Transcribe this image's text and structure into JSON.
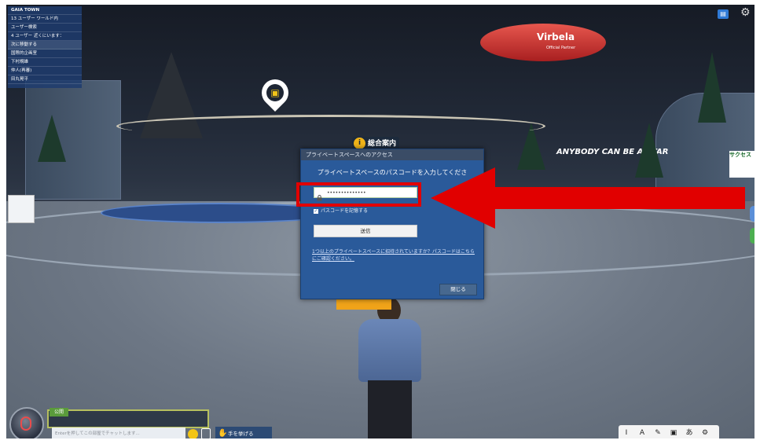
{
  "scene": {
    "location_panel": {
      "title": "GAIA TOWN",
      "rows": [
        "13 ユーザー ワールド内",
        "ユーザー検索",
        "4 ユーザー 近くにいます：",
        "次に移動する",
        "国際的企画室",
        "下村規雄",
        "仲人(再審)",
        "田丸晃平"
      ]
    },
    "blimp_brand": "Virbela",
    "blimp_tagline": "Official Partner",
    "info_sign": "総合案内",
    "building_banner": "ANYBODY CAN BE A STAR",
    "billboard_text": "サクセス"
  },
  "dialog": {
    "header": "プライベートスペースへのアクセス",
    "prompt": "プライベートスペースのパスコードを入力してくださ",
    "password_value": "••••••••••••••",
    "remember_label": "パスコードを記憶する",
    "submit_label": "送信",
    "help_text": "1つ以上のプライベートスペースに招待されていますか？パスコードはこちらにご確認ください。",
    "close_label": "閉じる"
  },
  "annotation": {
    "color": "#e10000",
    "target": "password-input"
  },
  "bottom_bar": {
    "channel_label": "公開",
    "chat_placeholder": "Enterを押してこの部屋でチャットします...",
    "raise_hand_label": "手を挙げる",
    "toolbar_icons": [
      "text-cursor-icon",
      "font-a-icon",
      "note-icon",
      "screen-icon",
      "translate-icon",
      "settings-gear-icon"
    ],
    "toolbar_glyphs": [
      "I",
      "A",
      "✎",
      "▣",
      "あ",
      "⚙"
    ]
  },
  "colors": {
    "dialog_bg": "#2a5a9a",
    "highlight_red": "#e10000"
  }
}
